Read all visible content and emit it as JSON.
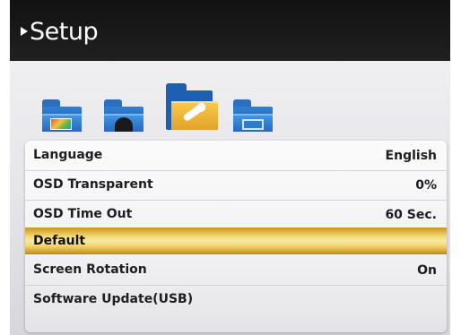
{
  "header": {
    "title": "Setup"
  },
  "folders": [
    {
      "icon": "picture-folder-icon",
      "selected": false
    },
    {
      "icon": "sound-folder-icon",
      "selected": false
    },
    {
      "icon": "setup-tools-folder-icon",
      "selected": true
    },
    {
      "icon": "screen-folder-icon",
      "selected": false
    }
  ],
  "menu": {
    "items": [
      {
        "label": "Language",
        "value": "English"
      },
      {
        "label": "OSD Transparent",
        "value": "0%"
      },
      {
        "label": "OSD Time Out",
        "value": "60 Sec."
      },
      {
        "label": "Default",
        "value": ""
      },
      {
        "label": "Screen Rotation",
        "value": "On"
      },
      {
        "label": "Software Update(USB)",
        "value": ""
      }
    ],
    "selected_index": 3
  },
  "colors": {
    "header_bg": "#161616",
    "folder_blue": "#2f7fd0",
    "folder_selected": "#e8b035",
    "highlight_gold": "#f5dd7a"
  }
}
